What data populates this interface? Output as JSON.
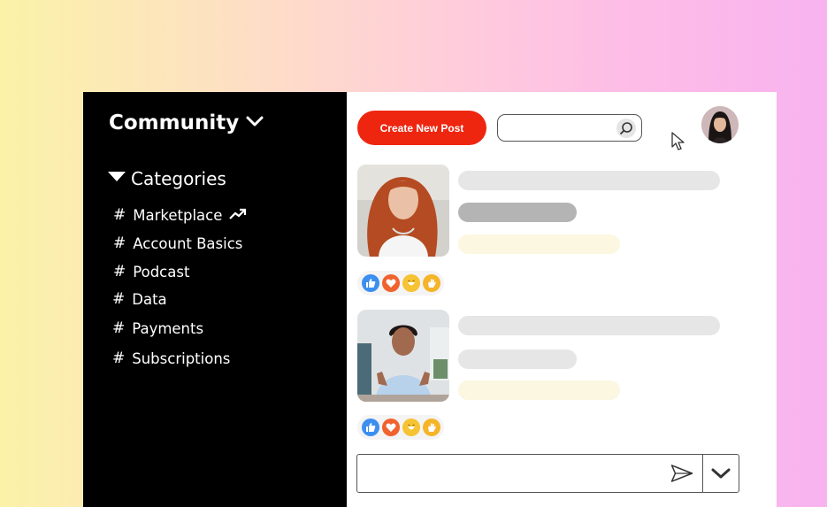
{
  "sidebar": {
    "title": "Community",
    "section_label": "Categories",
    "items": [
      {
        "label": "Marketplace",
        "trending": true
      },
      {
        "label": "Account Basics",
        "trending": false
      },
      {
        "label": "Podcast",
        "trending": false
      },
      {
        "label": "Data",
        "trending": false
      },
      {
        "label": "Payments",
        "trending": false
      },
      {
        "label": "Subscriptions",
        "trending": false
      }
    ],
    "hash_symbol": "#"
  },
  "header": {
    "create_button_label": "Create New Post",
    "search_placeholder": "",
    "search_icon": "search-icon",
    "avatar_icon": "user-avatar"
  },
  "posts": [
    {
      "author_image": "woman-red-hair-photo",
      "reactions": [
        "like",
        "love",
        "haha",
        "clap"
      ]
    },
    {
      "author_image": "woman-video-call-photo",
      "reactions": [
        "like",
        "love",
        "haha",
        "clap"
      ]
    }
  ],
  "composer": {
    "placeholder": "",
    "send_icon": "send-icon",
    "dropdown_icon": "chevron-down-icon"
  },
  "colors": {
    "accent": "#ee2610",
    "sidebar_bg": "#000000",
    "placeholder_light": "#e6e6e6",
    "placeholder_dark": "#b4b4b4",
    "placeholder_yellow": "#fbf7e0",
    "like": "#3b8ff0",
    "love": "#f0622e",
    "haha": "#f5c333",
    "clap": "#f5b52a"
  }
}
